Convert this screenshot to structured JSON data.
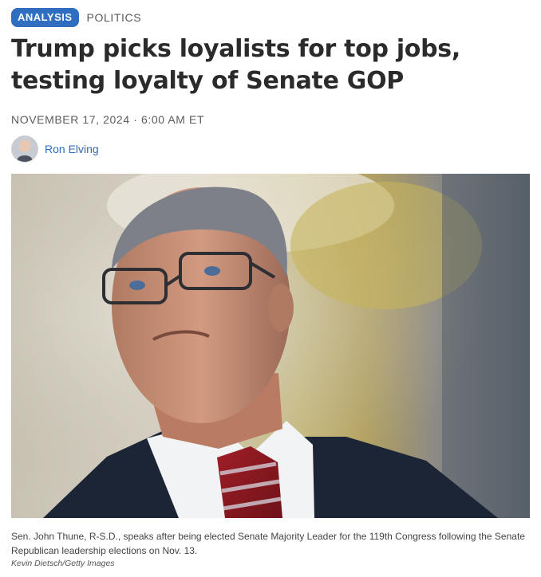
{
  "article": {
    "badge": "ANALYSIS",
    "section": "POLITICS",
    "headline": "Trump picks loyalists for top jobs, testing loyalty of Senate GOP",
    "dateline": "NOVEMBER 17, 2024 · 6:00 AM ET",
    "author": "Ron Elving"
  },
  "photo": {
    "caption": "Sen. John Thune, R-S.D., speaks after being elected Senate Majority Leader for the 119th Congress following the Senate Republican leadership elections on Nov. 13.",
    "credit": "Kevin Dietsch/Getty Images"
  }
}
